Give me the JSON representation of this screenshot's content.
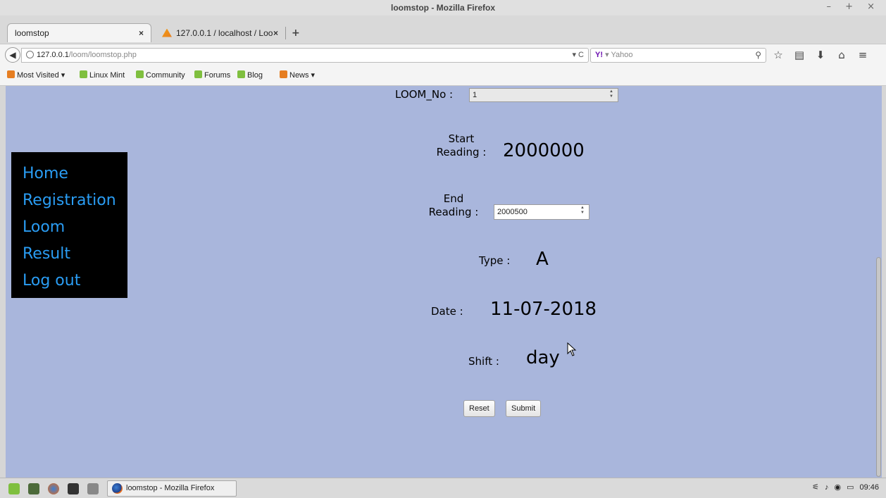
{
  "window": {
    "title": "loomstop - Mozilla Firefox",
    "controls": "– + ×"
  },
  "tabs": [
    {
      "label": "loomstop",
      "close": "×"
    },
    {
      "label": "127.0.0.1 / localhost / Loo...",
      "close": "×"
    }
  ],
  "newtab_symbol": "+",
  "navbar": {
    "back_symbol": "◀",
    "url_host": "127.0.0.1",
    "url_path": "/loom/loomstop.php",
    "url_right": "▾ C",
    "search_engine_logo": "Y!",
    "search_placeholder": "▾ Yahoo",
    "search_icon": "🔍",
    "icons": [
      "star-icon",
      "reading-list-icon",
      "download-icon",
      "home-icon",
      "menu-icon"
    ]
  },
  "bookmarks": [
    {
      "label": "Most Visited ▾",
      "icon": "most-visited-icon"
    },
    {
      "label": "Linux Mint",
      "icon": "mint-icon"
    },
    {
      "label": "Community",
      "icon": "mint-icon"
    },
    {
      "label": "Forums",
      "icon": "mint-icon"
    },
    {
      "label": "Blog",
      "icon": "mint-icon"
    },
    {
      "label": "News ▾",
      "icon": "rss-icon"
    }
  ],
  "sidebar": {
    "items": [
      {
        "label": "Home"
      },
      {
        "label": "Registration"
      },
      {
        "label": "Loom"
      },
      {
        "label": "Result"
      },
      {
        "label": "Log out"
      }
    ]
  },
  "form": {
    "loom_label": "LOOM_No :",
    "loom_value": "1",
    "start_label_1": "Start",
    "start_label_2": "Reading :",
    "start_value": "2000000",
    "end_label_1": "End",
    "end_label_2": "Reading :",
    "end_value": "2000500",
    "type_label": "Type :",
    "type_value": "A",
    "date_label": "Date :",
    "date_value": "11-07-2018",
    "shift_label": "Shift :",
    "shift_value": "day",
    "reset_label": "Reset",
    "submit_label": "Submit"
  },
  "taskbar": {
    "app_label": "loomstop - Mozilla Firefox",
    "clock": "09:46"
  },
  "colors": {
    "page_background": "#a9b6dc",
    "sidebar_background": "#000000",
    "sidebar_link": "#2a9df4"
  }
}
